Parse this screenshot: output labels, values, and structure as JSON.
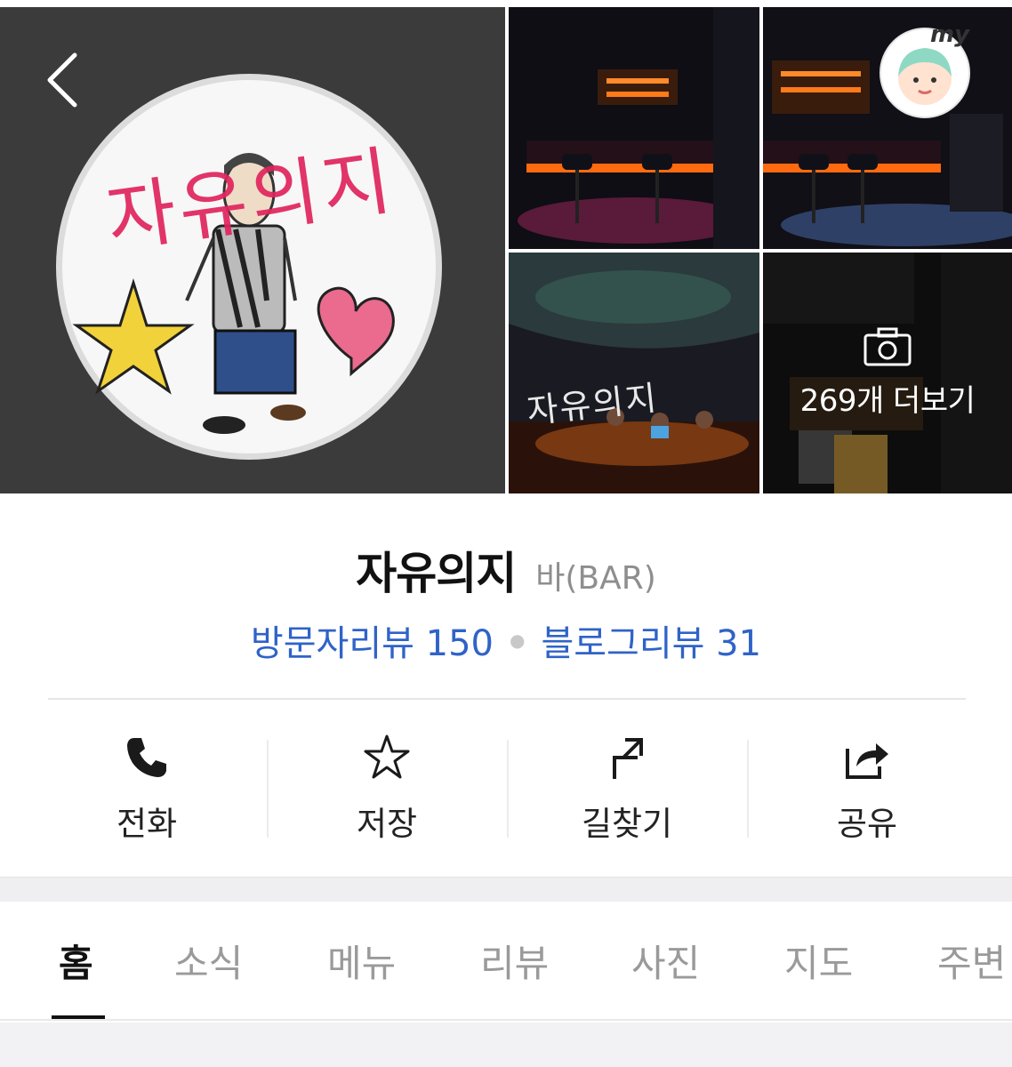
{
  "navigation": {
    "back_icon": "chevron-left-icon",
    "my_badge_text": "my"
  },
  "logo": {
    "text": "자유의지"
  },
  "gallery": {
    "more_label": "269개 더보기",
    "camera_icon": "camera-icon",
    "sign_text": "자유의지"
  },
  "place": {
    "name": "자유의지",
    "category": "바(BAR)",
    "visitor_reviews": "방문자리뷰 150",
    "blog_reviews": "블로그리뷰 31"
  },
  "actions": [
    {
      "label": "전화",
      "icon": "phone-icon"
    },
    {
      "label": "저장",
      "icon": "star-icon"
    },
    {
      "label": "길찾기",
      "icon": "directions-icon"
    },
    {
      "label": "공유",
      "icon": "share-icon"
    }
  ],
  "tabs": [
    {
      "label": "홈",
      "active": true
    },
    {
      "label": "소식",
      "active": false
    },
    {
      "label": "메뉴",
      "active": false
    },
    {
      "label": "리뷰",
      "active": false
    },
    {
      "label": "사진",
      "active": false
    },
    {
      "label": "지도",
      "active": false
    },
    {
      "label": "주변",
      "active": false
    }
  ],
  "colors": {
    "review_link": "#2f63c8",
    "logo_text": "#e0245e",
    "bar_light": "#ff7a1a"
  }
}
